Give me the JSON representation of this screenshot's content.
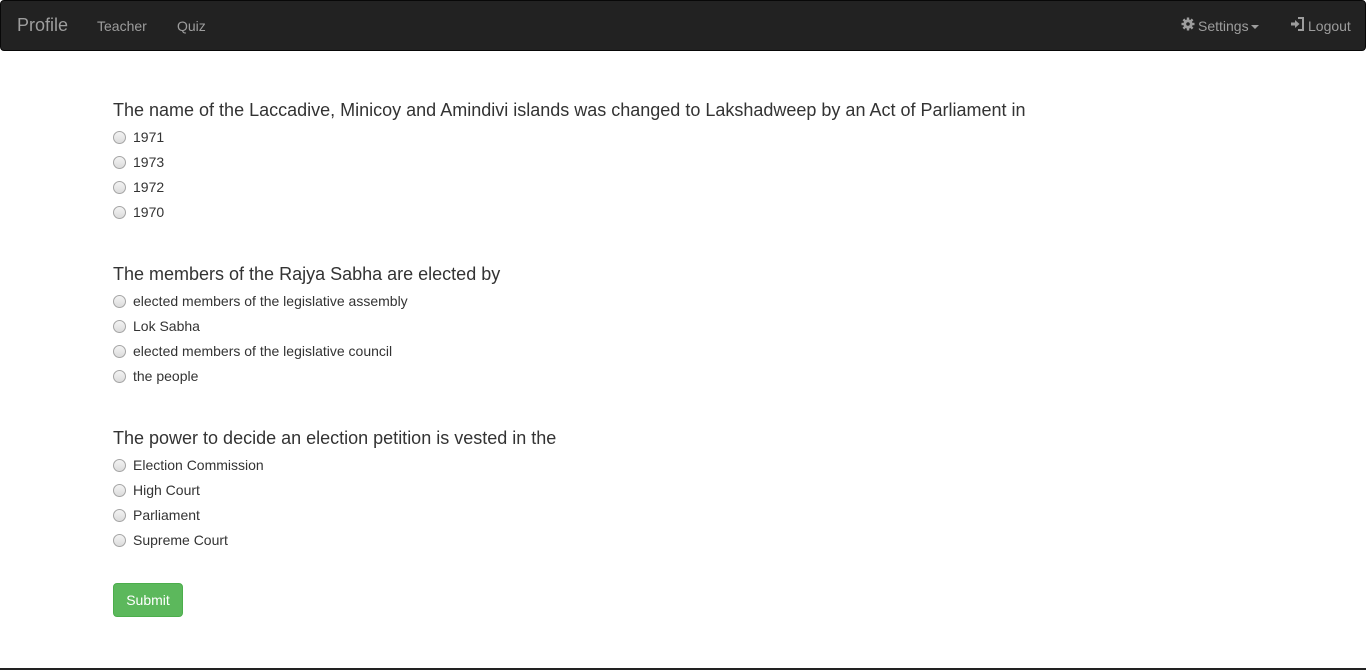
{
  "nav": {
    "brand": "Profile",
    "links": [
      "Teacher",
      "Quiz"
    ],
    "settings": "Settings",
    "logout": "Logout"
  },
  "questions": [
    {
      "text": "The name of the Laccadive, Minicoy and Amindivi islands was changed to Lakshadweep by an Act of Parliament in",
      "options": [
        "1971",
        "1973",
        "1972",
        "1970"
      ]
    },
    {
      "text": "The members of the Rajya Sabha are elected by",
      "options": [
        "elected members of the legislative assembly",
        "Lok Sabha",
        "elected members of the legislative council",
        "the people"
      ]
    },
    {
      "text": "The power to decide an election petition is vested in the",
      "options": [
        "Election Commission",
        "High Court",
        "Parliament",
        "Supreme Court"
      ]
    }
  ],
  "submit_label": "Submit",
  "colors": {
    "navbar": "#222222",
    "nav_text": "#9d9d9d",
    "submit": "#5cb85c"
  }
}
